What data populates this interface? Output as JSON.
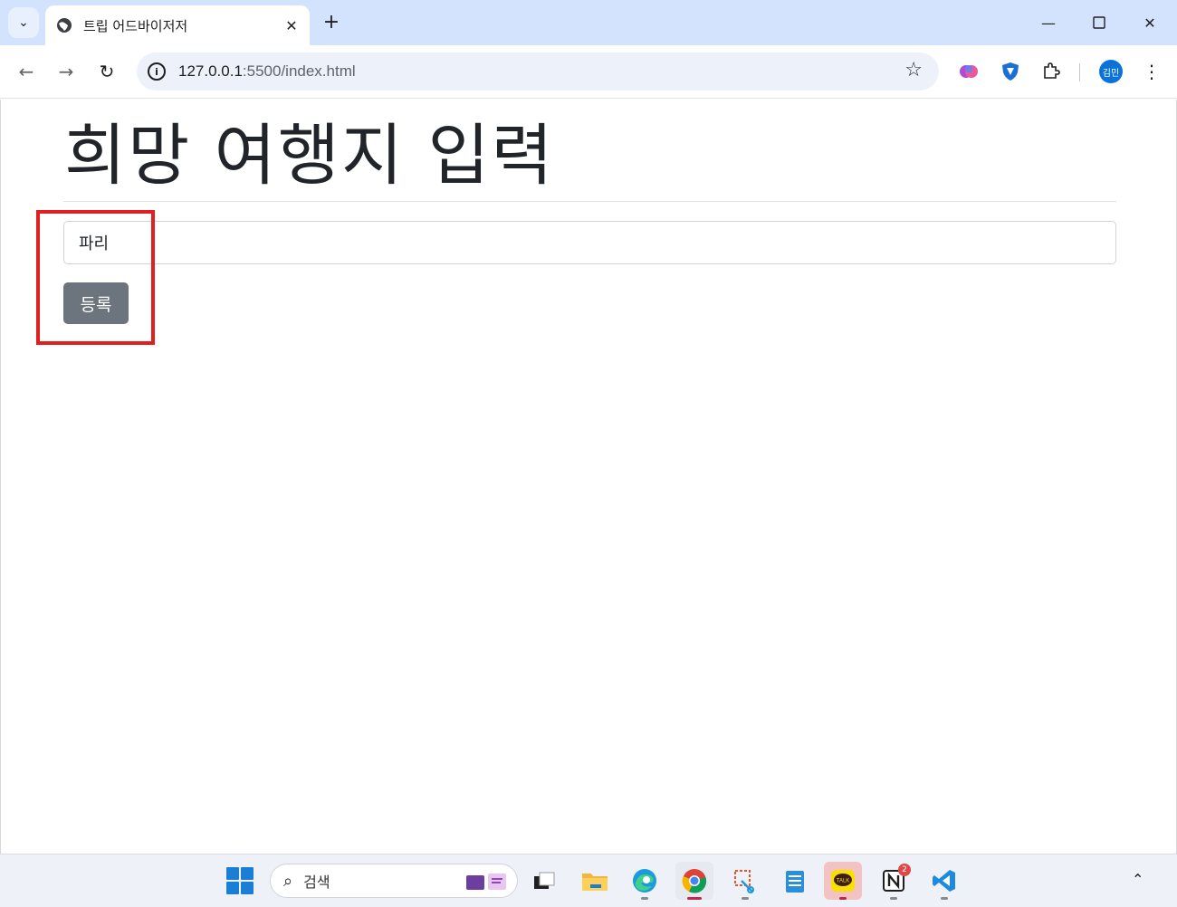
{
  "browser": {
    "tab_title": "트립 어드바이저저",
    "url_host": "127.0.0.1",
    "url_path": ":5500/index.html",
    "profile_initials": "김민"
  },
  "page": {
    "title": "희망 여행지 입력",
    "input_value": "파리",
    "submit_label": "등록"
  },
  "taskbar": {
    "search_placeholder": "검색",
    "notion_badge": "2",
    "kakao_label": "TALK"
  },
  "colors": {
    "tabbar_bg": "#d3e3fd",
    "button_bg": "#6c757d",
    "highlight_border": "#e02020",
    "avatar_bg": "#0b72d9"
  },
  "icons": [
    "tab-search-icon",
    "globe-icon",
    "close-icon",
    "plus-icon",
    "minimize-icon",
    "maximize-icon",
    "window-close-icon",
    "back-icon",
    "forward-icon",
    "reload-icon",
    "info-icon",
    "star-icon",
    "brain-extension-icon",
    "shield-extension-icon",
    "puzzle-icon",
    "kebab-menu-icon",
    "windows-start-icon",
    "search-icon",
    "task-view-icon",
    "file-explorer-icon",
    "edge-icon",
    "chrome-icon",
    "snipping-tool-icon",
    "notepad-icon",
    "kakaotalk-icon",
    "notion-icon",
    "vscode-icon",
    "chevron-up-icon"
  ]
}
